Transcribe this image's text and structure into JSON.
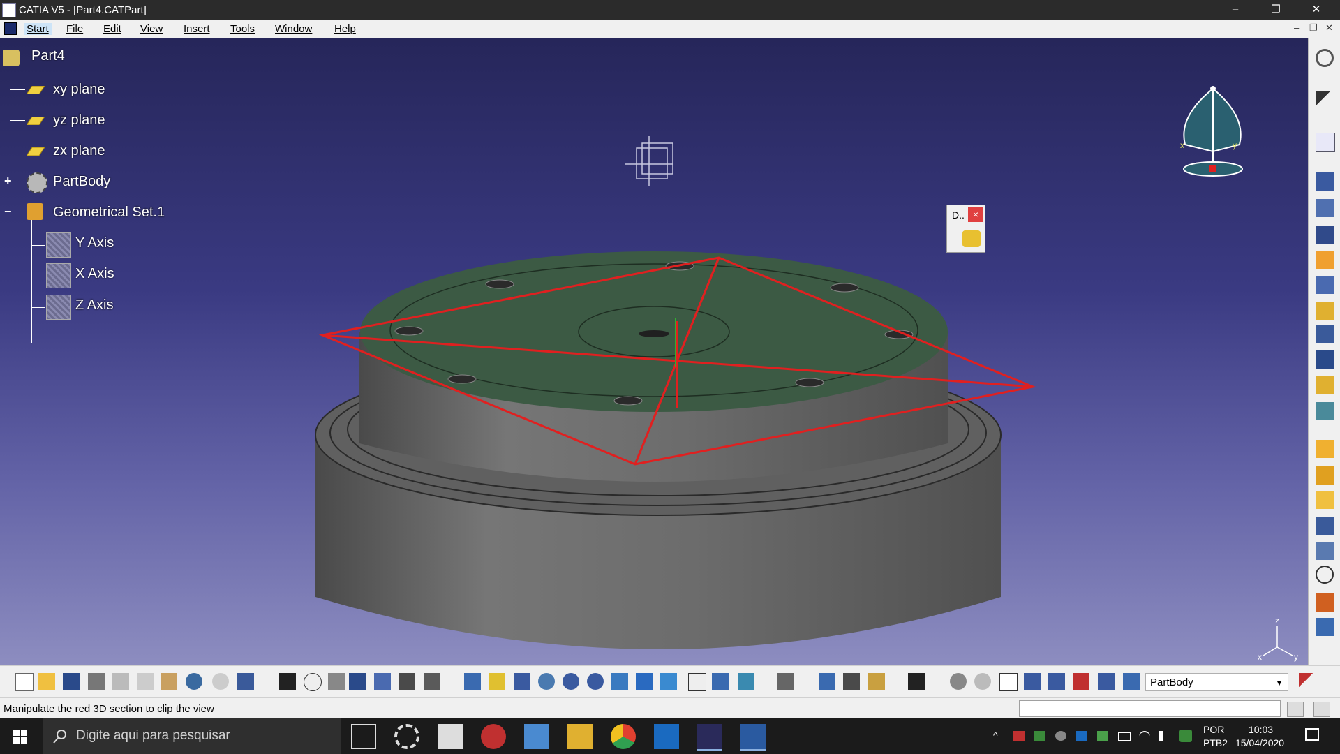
{
  "window": {
    "title": "CATIA V5 - [Part4.CATPart]",
    "minimize": "–",
    "restore": "❐",
    "close": "✕"
  },
  "menu": {
    "items": [
      "Start",
      "File",
      "Edit",
      "View",
      "Insert",
      "Tools",
      "Window",
      "Help"
    ],
    "mdi_minimize": "–",
    "mdi_restore": "❐",
    "mdi_close": "✕"
  },
  "tree": {
    "root": "Part4",
    "items": [
      "xy plane",
      "yz plane",
      "zx plane",
      "PartBody",
      "Geometrical Set.1",
      "Y Axis",
      "X Axis",
      "Z Axis"
    ],
    "expand_plus": "+",
    "collapse_minus": "−"
  },
  "dialog": {
    "title": "D..",
    "close": "×"
  },
  "compass_axes": {
    "x": "x",
    "y": "y",
    "z": "z"
  },
  "toolbar": {
    "body_selector": "PartBody"
  },
  "status": {
    "message": "Manipulate the red 3D section to clip the view"
  },
  "taskbar": {
    "search_placeholder": "Digite aqui para pesquisar",
    "language": "POR",
    "layout": "PTB2",
    "time": "10:03",
    "date": "15/04/2020"
  },
  "colors": {
    "viewport_top": "#26265a",
    "viewport_bottom": "#8d8dc0",
    "part_top": "#3c5a44",
    "part_body": "#6a6a6a",
    "section_plane": "#e02020"
  }
}
